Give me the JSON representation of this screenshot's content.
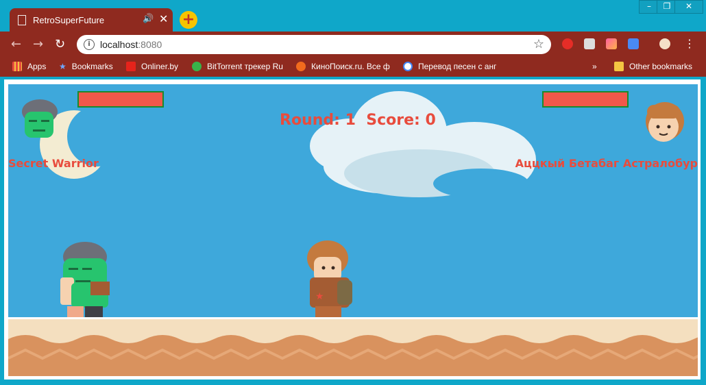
{
  "browser": {
    "tab_title": "RetroSuperFuture",
    "new_tab": "+",
    "url_host": "localhost",
    "url_port": ":8080",
    "window_controls": [
      "–",
      "❐",
      "✕"
    ]
  },
  "bookmarks": [
    {
      "label": "Apps",
      "icon": "apps-grid-icon",
      "color": "#e84c3d"
    },
    {
      "label": "Bookmarks",
      "icon": "star-icon",
      "color": "#6fa8ff"
    },
    {
      "label": "Onliner.by",
      "icon": "onliner-icon",
      "color": "#e6231b"
    },
    {
      "label": "BitTorrent трекер Ru",
      "icon": "torrent-icon",
      "color": "#38b34a"
    },
    {
      "label": "КиноПоиск.ru. Все ф",
      "icon": "film-reel-icon",
      "color": "#f26b1d"
    },
    {
      "label": "Перевод песен с анг",
      "icon": "translate-icon",
      "color": "#4285f4"
    },
    {
      "label": "Other bookmarks",
      "icon": "folder-icon",
      "color": "#f4c542"
    }
  ],
  "overflow_label": "»",
  "game": {
    "round_label": "Round:",
    "round": "1",
    "score_label": "Score:",
    "score": "0",
    "player1": {
      "name": "Secret Warrior",
      "health": 1.0
    },
    "player2": {
      "name": "Аццкый Бетабаг Астралобур",
      "health": 1.0
    },
    "sky_color": "#3ea8db",
    "text_color": "#e84c3d"
  }
}
